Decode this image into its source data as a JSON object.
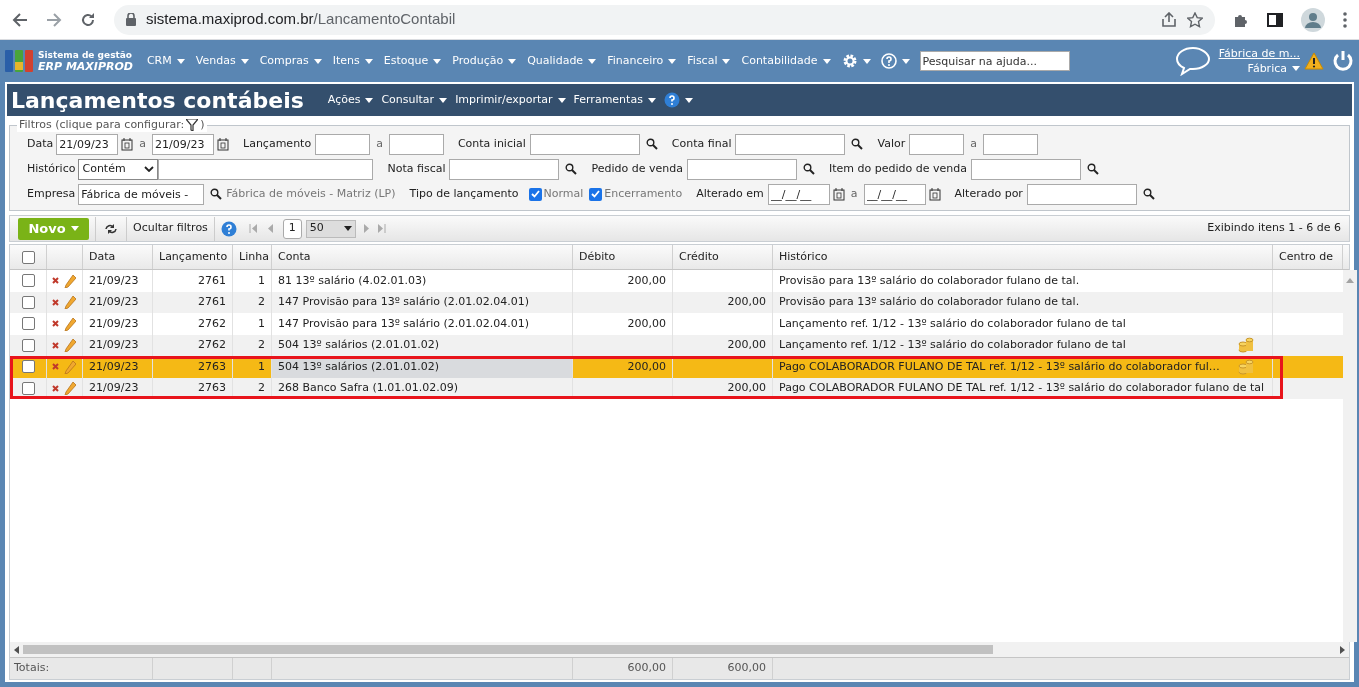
{
  "browser": {
    "url_host": "sistema.maxiprod.com.br",
    "url_path": "/LancamentoContabil"
  },
  "app_header": {
    "brand_top": "Sistema de gestão",
    "brand_bottom": "ERP MAXIPROD",
    "menu": [
      "CRM",
      "Vendas",
      "Compras",
      "Itens",
      "Estoque",
      "Produção",
      "Qualidade",
      "Financeiro",
      "Fiscal",
      "Contabilidade"
    ],
    "help_search_placeholder": "Pesquisar na ajuda...",
    "company_link": "Fábrica de m...",
    "company_menu": "Fábrica"
  },
  "page": {
    "title": "Lançamentos contábeis",
    "menu": [
      "Ações",
      "Consultar",
      "Imprimir/exportar",
      "Ferramentas"
    ]
  },
  "filters": {
    "legend": "Filtros (clique para configurar:",
    "legend_end": ")",
    "rows": [
      {
        "fields": [
          {
            "label": "Data",
            "controls": [
              {
                "kind": "date",
                "value": "21/09/23"
              },
              {
                "kind": "sep",
                "text": "a"
              },
              {
                "kind": "date",
                "value": "21/09/23"
              }
            ]
          },
          {
            "label": "Lançamento",
            "controls": [
              {
                "kind": "input"
              },
              {
                "kind": "sep",
                "text": "a"
              },
              {
                "kind": "input"
              }
            ]
          },
          {
            "label": "Conta inicial",
            "controls": [
              {
                "kind": "lookup"
              }
            ]
          },
          {
            "label": "Conta final",
            "controls": [
              {
                "kind": "lookup"
              }
            ]
          },
          {
            "label": "Valor",
            "controls": [
              {
                "kind": "input"
              },
              {
                "kind": "sep",
                "text": "a"
              },
              {
                "kind": "input"
              }
            ]
          }
        ]
      },
      {
        "fields": [
          {
            "label": "Histórico",
            "controls": [
              {
                "kind": "select",
                "value": "Contém"
              },
              {
                "kind": "wide_input"
              }
            ]
          },
          {
            "label": "Nota fiscal",
            "controls": [
              {
                "kind": "lookup"
              }
            ]
          },
          {
            "label": "Pedido de venda",
            "controls": [
              {
                "kind": "lookup"
              }
            ]
          },
          {
            "label": "Item do pedido de venda",
            "controls": [
              {
                "kind": "lookup"
              }
            ]
          }
        ]
      },
      {
        "fields": [
          {
            "label": "Empresa",
            "controls": [
              {
                "kind": "lookup",
                "value": "Fábrica de móveis -"
              },
              {
                "kind": "note",
                "text": "Fábrica de móveis - Matriz (LP)"
              }
            ]
          },
          {
            "label": "Tipo de lançamento",
            "controls": [
              {
                "kind": "check",
                "text": "Normal",
                "checked": true
              },
              {
                "kind": "check",
                "text": "Encerramento",
                "checked": true
              }
            ]
          },
          {
            "label": "Alterado em",
            "controls": [
              {
                "kind": "date",
                "value": "__/__/__"
              },
              {
                "kind": "sep",
                "text": "a"
              },
              {
                "kind": "date",
                "value": "__/__/__"
              }
            ]
          },
          {
            "label": "Alterado por",
            "controls": [
              {
                "kind": "lookup"
              }
            ]
          }
        ]
      }
    ]
  },
  "toolbar": {
    "new_button": "Novo",
    "hide_filters": "Ocultar filtros",
    "page": "1",
    "page_size": "50",
    "summary": "Exibindo itens 1 - 6 de 6"
  },
  "table": {
    "header_checked": false,
    "columns": [
      "Data",
      "Lançamento",
      "Linha",
      "Conta",
      "Débito",
      "Crédito",
      "Histórico",
      "Centro de"
    ],
    "rows": [
      {
        "data": "21/09/23",
        "lancamento": "2761",
        "linha": "1",
        "conta": "81 13º salário (4.02.01.03)",
        "debito": "200,00",
        "historico": "Provisão para 13º salário do colaborador fulano de tal.",
        "checked": false,
        "selected": false,
        "has_attachment": false,
        "outlined": false
      },
      {
        "data": "21/09/23",
        "lancamento": "2761",
        "linha": "2",
        "conta": "147 Provisão para 13º salário (2.01.02.04.01)",
        "credito": "200,00",
        "historico": "Provisão para 13º salário do colaborador fulano de tal.",
        "checked": false,
        "selected": false,
        "has_attachment": false,
        "outlined": false
      },
      {
        "data": "21/09/23",
        "lancamento": "2762",
        "linha": "1",
        "conta": "147 Provisão para 13º salário (2.01.02.04.01)",
        "debito": "200,00",
        "historico": "Lançamento ref. 1/12 - 13º salário do colaborador fulano de tal",
        "checked": false,
        "selected": false,
        "has_attachment": false,
        "outlined": false
      },
      {
        "data": "21/09/23",
        "lancamento": "2762",
        "linha": "2",
        "conta": "504 13º salários (2.01.01.02)",
        "credito": "200,00",
        "historico": "Lançamento ref. 1/12 - 13º salário do colaborador fulano de tal",
        "checked": false,
        "selected": false,
        "has_attachment": true,
        "outlined": false
      },
      {
        "data": "21/09/23",
        "lancamento": "2763",
        "linha": "1",
        "conta": "504 13º salários (2.01.01.02)",
        "debito": "200,00",
        "historico": "Pago COLABORADOR FULANO DE TAL ref. 1/12 - 13º salário do colaborador ful…",
        "checked": false,
        "selected": true,
        "has_attachment": true,
        "outlined": true
      },
      {
        "data": "21/09/23",
        "lancamento": "2763",
        "linha": "2",
        "conta": "268 Banco Safra (1.01.01.02.09)",
        "credito": "200,00",
        "historico": "Pago COLABORADOR FULANO DE TAL ref. 1/12 - 13º salário do colaborador fulano de tal",
        "checked": false,
        "selected": false,
        "has_attachment": false,
        "outlined": true
      }
    ],
    "totals": {
      "label": "Totais:",
      "debito": "600,00",
      "credito": "600,00"
    }
  }
}
